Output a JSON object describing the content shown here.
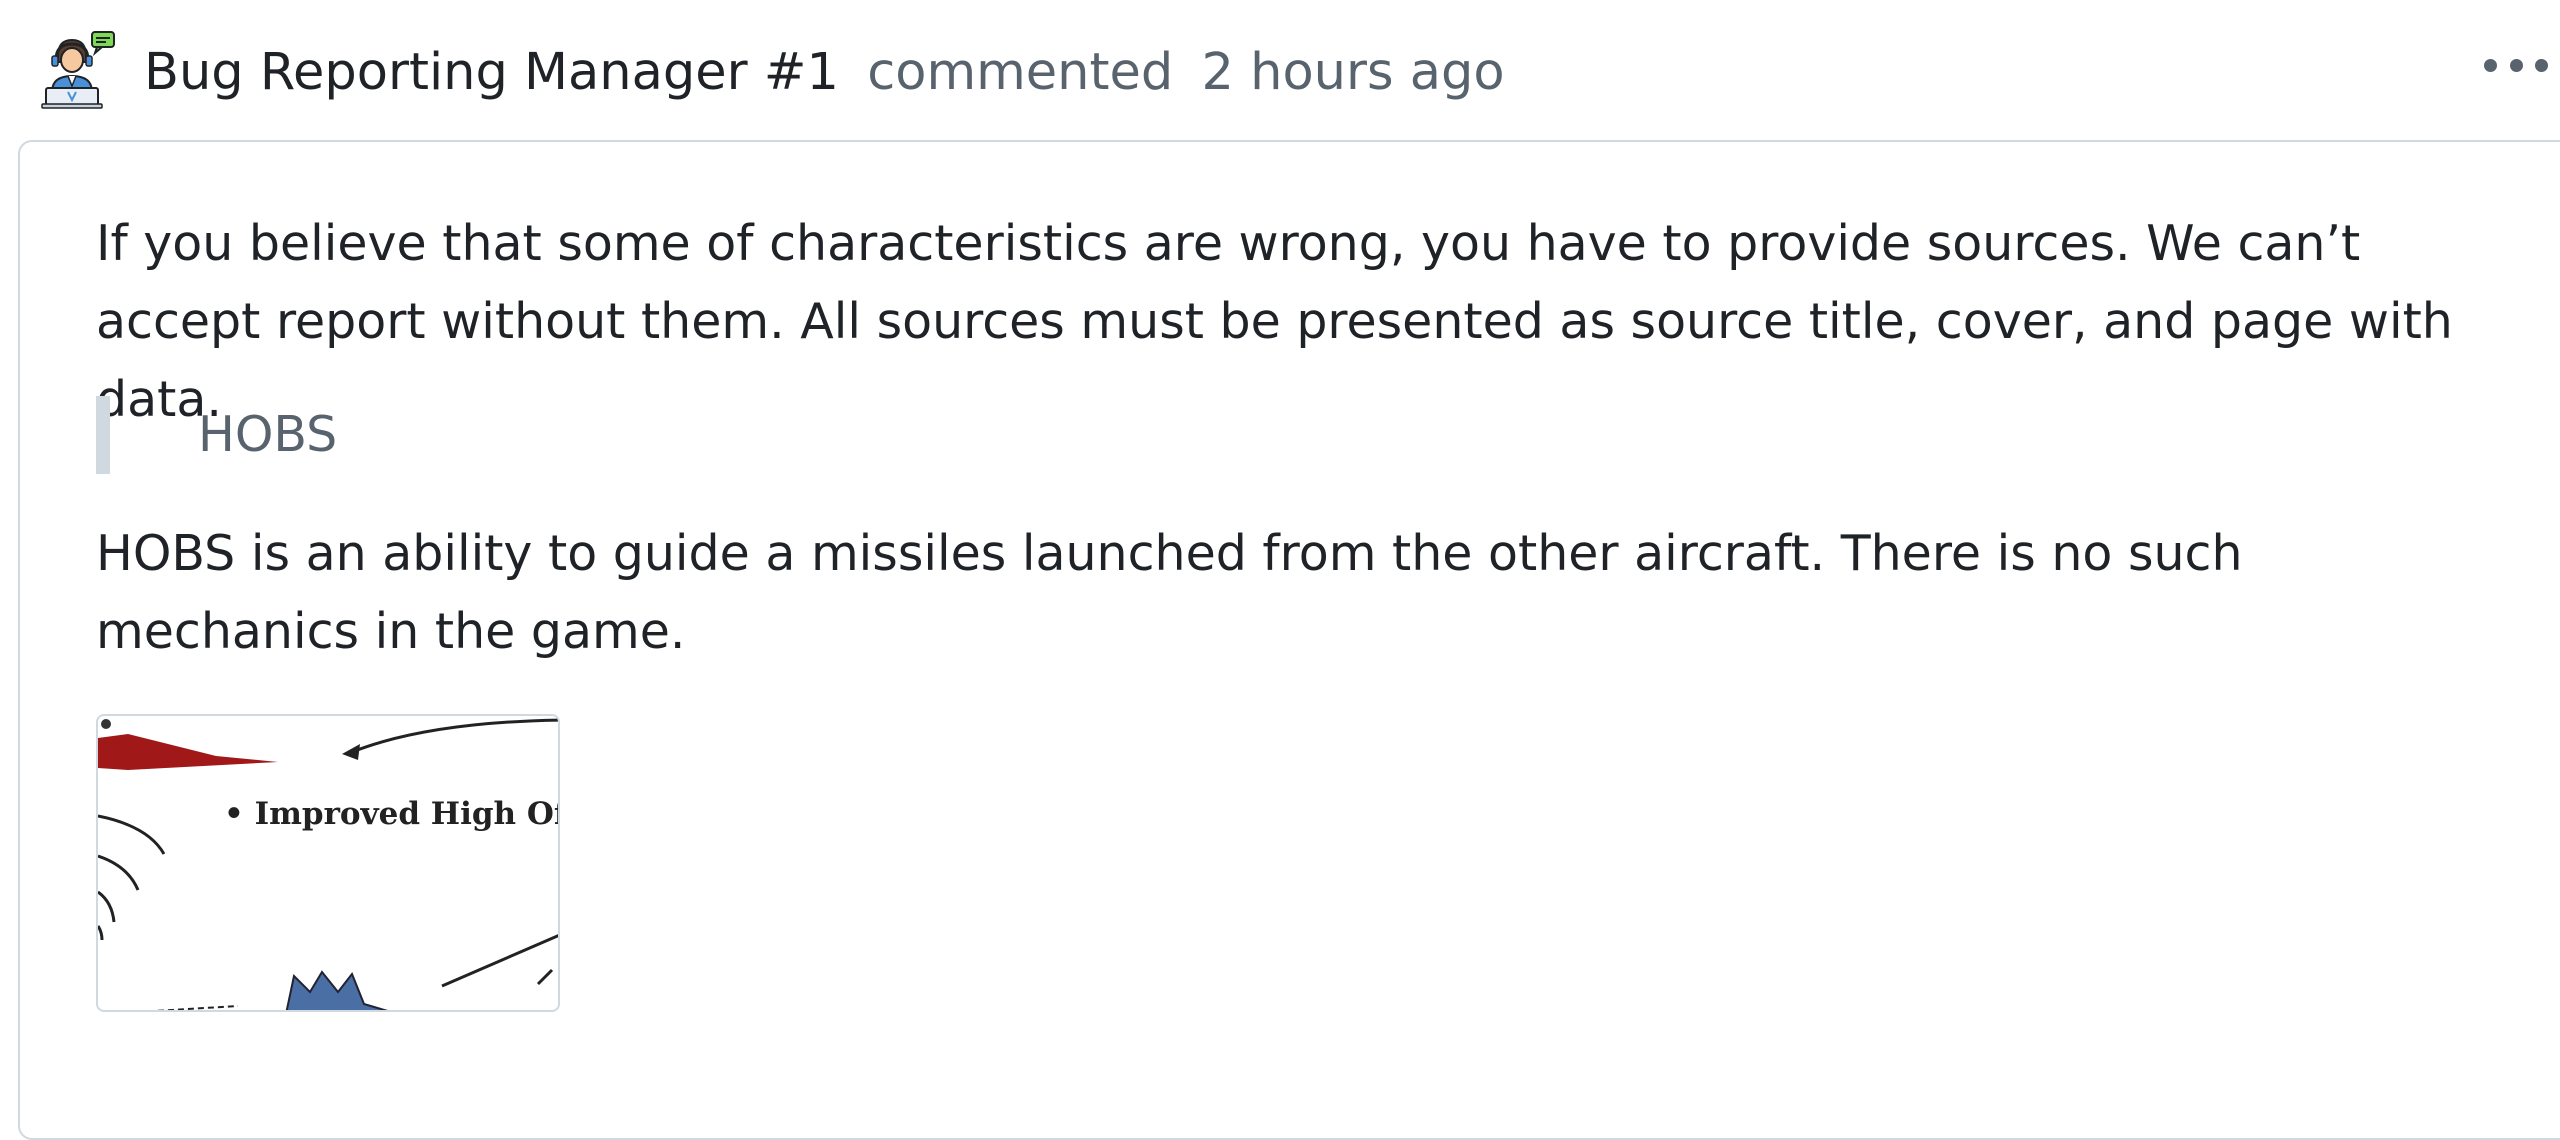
{
  "comment": {
    "author": "Bug Reporting Manager #1",
    "action": "commented",
    "time": "2 hours ago",
    "avatar_icon": "support-agent-icon",
    "more_icon": "kebab-menu-icon",
    "paragraphs": [
      "If you believe that some of characteristics are wrong, you have to provide sources. We can’t accept report without them. All sources must be presented as source title, cover, and page with data.",
      "HOBS is an ability to guide a missiles launched from the other aircraft. There is no such mechanics in the game."
    ],
    "quote": "HOBS",
    "image": {
      "caption": "• Improved High Off"
    }
  },
  "colors": {
    "text": "#1f2328",
    "muted": "#59636e",
    "border": "#d1d9e0"
  }
}
